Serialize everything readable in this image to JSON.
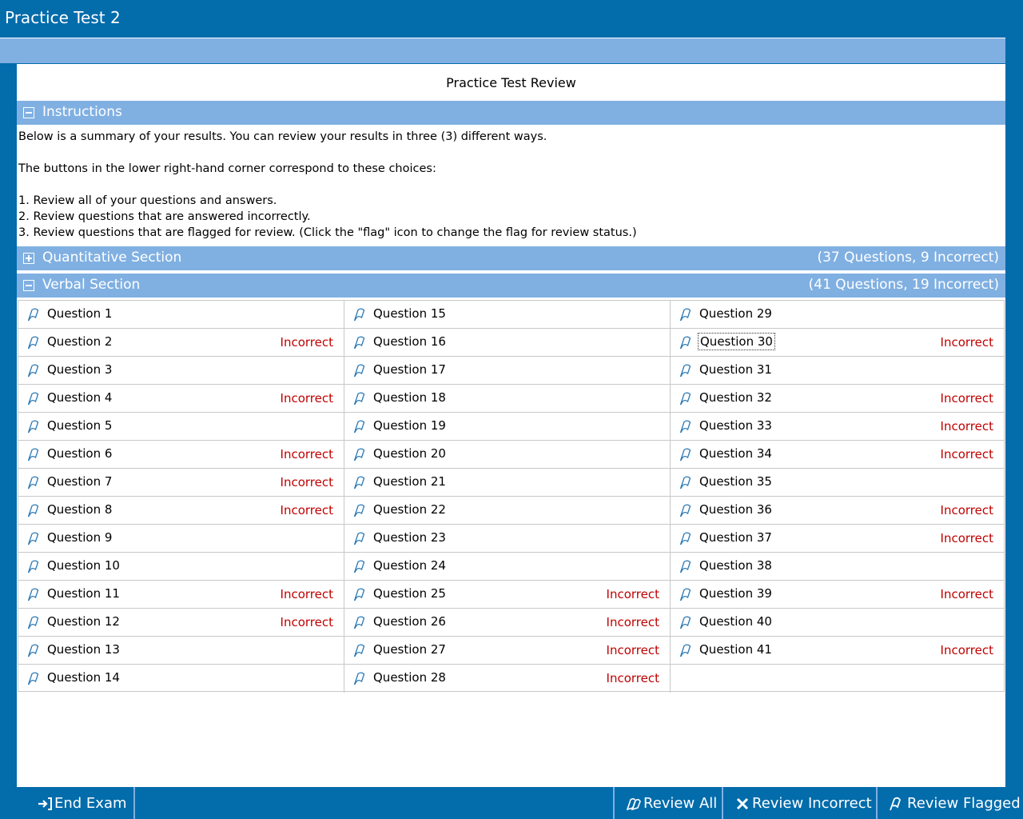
{
  "window": {
    "title": "Practice Test 2"
  },
  "page": {
    "title": "Practice Test Review"
  },
  "instructions": {
    "heading": "Instructions",
    "lines": [
      "Below is a summary of your results. You can review your results in three (3) different ways.",
      "The buttons in the lower right-hand corner correspond to these choices:",
      "1. Review all of your questions and answers.",
      "2. Review questions that are answered incorrectly.",
      "3. Review questions that are flagged for review. (Click the \"flag\" icon to change the flag for review status.)"
    ]
  },
  "sections": [
    {
      "name": "Quantitative Section",
      "summary": "(37 Questions, 9 Incorrect)",
      "expanded": false
    },
    {
      "name": "Verbal Section",
      "summary": "(41 Questions, 19 Incorrect)",
      "expanded": true
    }
  ],
  "questions": [
    {
      "label": "Question 1",
      "status": ""
    },
    {
      "label": "Question 2",
      "status": "Incorrect"
    },
    {
      "label": "Question 3",
      "status": ""
    },
    {
      "label": "Question 4",
      "status": "Incorrect"
    },
    {
      "label": "Question 5",
      "status": ""
    },
    {
      "label": "Question 6",
      "status": "Incorrect"
    },
    {
      "label": "Question 7",
      "status": "Incorrect"
    },
    {
      "label": "Question 8",
      "status": "Incorrect"
    },
    {
      "label": "Question 9",
      "status": ""
    },
    {
      "label": "Question 10",
      "status": ""
    },
    {
      "label": "Question 11",
      "status": "Incorrect"
    },
    {
      "label": "Question 12",
      "status": "Incorrect"
    },
    {
      "label": "Question 13",
      "status": ""
    },
    {
      "label": "Question 14",
      "status": ""
    },
    {
      "label": "Question 15",
      "status": ""
    },
    {
      "label": "Question 16",
      "status": ""
    },
    {
      "label": "Question 17",
      "status": ""
    },
    {
      "label": "Question 18",
      "status": ""
    },
    {
      "label": "Question 19",
      "status": ""
    },
    {
      "label": "Question 20",
      "status": ""
    },
    {
      "label": "Question 21",
      "status": ""
    },
    {
      "label": "Question 22",
      "status": ""
    },
    {
      "label": "Question 23",
      "status": ""
    },
    {
      "label": "Question 24",
      "status": ""
    },
    {
      "label": "Question 25",
      "status": "Incorrect"
    },
    {
      "label": "Question 26",
      "status": "Incorrect"
    },
    {
      "label": "Question 27",
      "status": "Incorrect"
    },
    {
      "label": "Question 28",
      "status": "Incorrect"
    },
    {
      "label": "Question 29",
      "status": ""
    },
    {
      "label": "Question 30",
      "status": "Incorrect",
      "focused": true
    },
    {
      "label": "Question 31",
      "status": ""
    },
    {
      "label": "Question 32",
      "status": "Incorrect"
    },
    {
      "label": "Question 33",
      "status": "Incorrect"
    },
    {
      "label": "Question 34",
      "status": "Incorrect"
    },
    {
      "label": "Question 35",
      "status": ""
    },
    {
      "label": "Question 36",
      "status": "Incorrect"
    },
    {
      "label": "Question 37",
      "status": "Incorrect"
    },
    {
      "label": "Question 38",
      "status": ""
    },
    {
      "label": "Question 39",
      "status": "Incorrect"
    },
    {
      "label": "Question 40",
      "status": ""
    },
    {
      "label": "Question 41",
      "status": "Incorrect"
    }
  ],
  "footer": {
    "end_exam": {
      "label": "End Exam",
      "icon": "exit-icon"
    },
    "review_all": {
      "label": "Review All",
      "icon": "review-all-icon"
    },
    "review_incorrect": {
      "label": "Review Incorrect",
      "icon": "x-icon"
    },
    "review_flagged": {
      "label": "Review Flagged",
      "icon": "flag-icon"
    }
  },
  "colors": {
    "chrome_blue": "#036cab",
    "section_blue": "#80b0e2",
    "incorrect_red": "#c00000"
  }
}
